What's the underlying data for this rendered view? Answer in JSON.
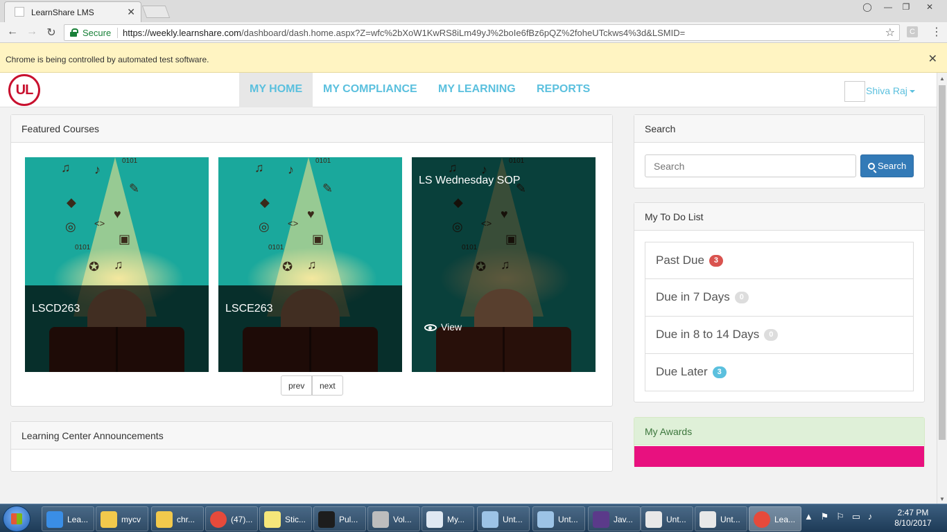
{
  "browser": {
    "tab_title": "LearnShare LMS",
    "secure_label": "Secure",
    "url_host": "https://weekly.learnshare.com",
    "url_path": "/dashboard/dash.home.aspx?Z=wfc%2bXoW1KwRS8iLm49yJ%2boIe6fBz6pQZ%2foheUTckws4%3d&LSMID=",
    "infobar_text": "Chrome is being controlled by automated test software."
  },
  "header": {
    "logo_text": "UL",
    "nav": [
      "MY HOME",
      "MY COMPLIANCE",
      "MY LEARNING",
      "REPORTS"
    ],
    "active_nav": "MY HOME",
    "user_name": "Shiva Raj"
  },
  "featured": {
    "heading": "Featured Courses",
    "courses": [
      {
        "title": "LSCD263"
      },
      {
        "title": "LSCE263"
      },
      {
        "title": "LS Wednesday SOP",
        "action": "View"
      }
    ],
    "prev_label": "prev",
    "next_label": "next"
  },
  "announcements": {
    "heading": "Learning Center Announcements"
  },
  "search": {
    "heading": "Search",
    "placeholder": "Search",
    "button_label": "Search"
  },
  "todo": {
    "heading": "My To Do List",
    "items": [
      {
        "label": "Past Due",
        "count": "3",
        "color": "#d9534f"
      },
      {
        "label": "Due in 7 Days",
        "count": "0",
        "color": "#dddddd"
      },
      {
        "label": "Due in 8 to 14 Days",
        "count": "0",
        "color": "#dddddd"
      },
      {
        "label": "Due Later",
        "count": "3",
        "color": "#5bc0de"
      }
    ]
  },
  "awards": {
    "heading": "My Awards"
  },
  "taskbar": {
    "items": [
      {
        "label": "Lea...",
        "icon": "ie-icon"
      },
      {
        "label": "mycv",
        "icon": "folder-icon"
      },
      {
        "label": "chr...",
        "icon": "folder-icon"
      },
      {
        "label": "(47)...",
        "icon": "chrome-icon"
      },
      {
        "label": "Stic...",
        "icon": "sticky-notes-icon"
      },
      {
        "label": "Pul...",
        "icon": "pulse-icon"
      },
      {
        "label": "Vol...",
        "icon": "volume-icon"
      },
      {
        "label": "My...",
        "icon": "workbench-icon"
      },
      {
        "label": "Unt...",
        "icon": "notepad-icon"
      },
      {
        "label": "Unt...",
        "icon": "notepad-icon"
      },
      {
        "label": "Jav...",
        "icon": "eclipse-icon"
      },
      {
        "label": "Unt...",
        "icon": "paint-icon"
      },
      {
        "label": "Unt...",
        "icon": "paint-icon"
      },
      {
        "label": "Lea...",
        "icon": "chrome-icon"
      }
    ],
    "time": "2:47 PM",
    "date": "8/10/2017"
  }
}
